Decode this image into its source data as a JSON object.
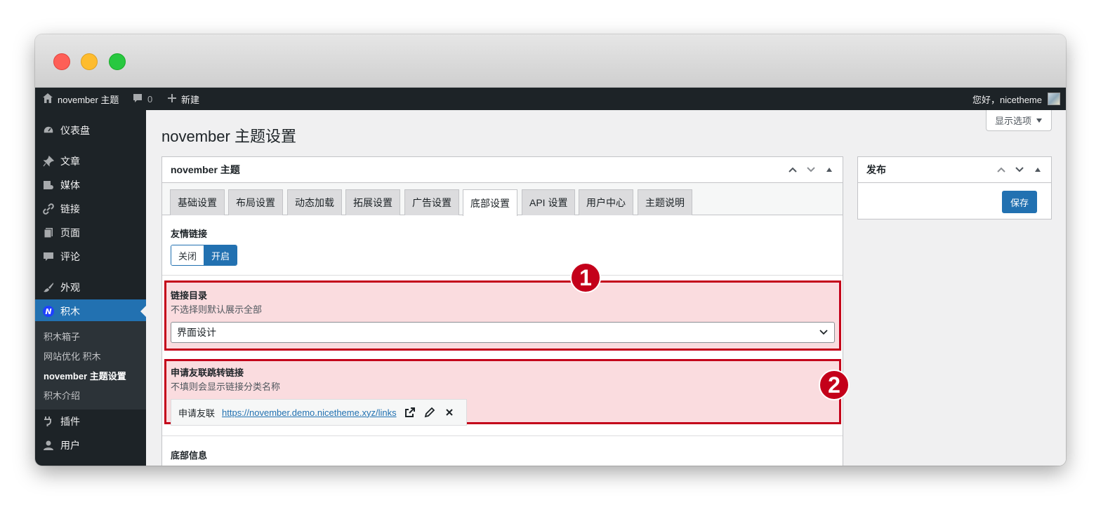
{
  "colors": {
    "accent": "#2271b1",
    "admin_bar": "#1d2327",
    "highlight": "#c4001a"
  },
  "admin_bar": {
    "site_name": "november 主题",
    "comments_count": "0",
    "new_label": "新建",
    "greeting": "您好，nicetheme"
  },
  "sidebar": {
    "items": [
      {
        "label": "仪表盘",
        "icon": "dashboard-icon"
      },
      {
        "label": "文章",
        "icon": "pin-icon"
      },
      {
        "label": "媒体",
        "icon": "media-icon"
      },
      {
        "label": "链接",
        "icon": "link-icon"
      },
      {
        "label": "页面",
        "icon": "page-icon"
      },
      {
        "label": "评论",
        "icon": "comment-icon"
      },
      {
        "label": "外观",
        "icon": "brush-icon"
      },
      {
        "label": "积木",
        "icon": "jimu-logo-icon"
      },
      {
        "label": "插件",
        "icon": "plugin-icon"
      },
      {
        "label": "用户",
        "icon": "user-icon"
      }
    ],
    "submenu": [
      "积木箱子",
      "网站优化 积木",
      "november 主题设置",
      "积木介绍"
    ]
  },
  "page": {
    "title": "november 主题设置",
    "screen_options": "显示选项"
  },
  "main_box": {
    "title": "november 主题",
    "tabs": [
      "基础设置",
      "布局设置",
      "动态加载",
      "拓展设置",
      "广告设置",
      "底部设置",
      "API 设置",
      "用户中心",
      "主题说明"
    ],
    "active_tab": "底部设置",
    "friend_links": {
      "title": "友情链接",
      "off_label": "关闭",
      "on_label": "开启",
      "value": "开启"
    },
    "link_category": {
      "title": "链接目录",
      "desc": "不选择则默认展示全部",
      "selected": "界面设计"
    },
    "apply_link": {
      "title": "申请友联跳转链接",
      "desc": "不填则会显示链接分类名称",
      "link_text": "申请友联",
      "url": "https://november.demo.nicetheme.xyz/links"
    },
    "footer_info": {
      "title": "底部信息"
    }
  },
  "side_box": {
    "title": "发布",
    "save_label": "保存"
  },
  "annotations": [
    "1",
    "2"
  ]
}
